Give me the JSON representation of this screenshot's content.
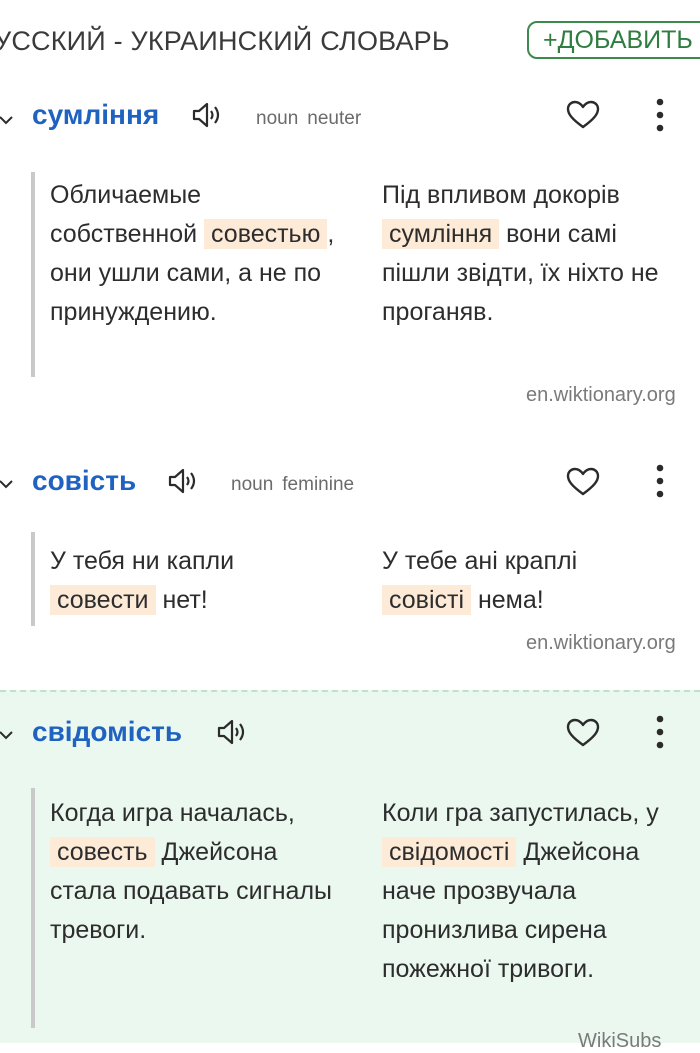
{
  "header": {
    "title": "УССКИЙ - УКРАИНСКИЙ СЛОВАРЬ",
    "add_button": "+ДОБАВИТЬ"
  },
  "entries": [
    {
      "word": "сумління",
      "pos": "noun",
      "gender": "neuter",
      "ru": {
        "before": "Обличаемые собственной",
        "hl": "совестью",
        "after": ", они ушли сами, а не по принуждению."
      },
      "uk": {
        "before": "Під впливом докорів",
        "hl": "сумління",
        "after": " вони самі пішли звідти, їх ніхто не проганяв."
      },
      "source": "en.wiktionary.org"
    },
    {
      "word": "совість",
      "pos": "noun",
      "gender": "feminine",
      "ru": {
        "before": "У тебя ни капли",
        "hl": "совести",
        "after": " нет!"
      },
      "uk": {
        "before": "У тебе ані краплі",
        "hl": "совісті",
        "after": " нема!"
      },
      "source": "en.wiktionary.org"
    },
    {
      "word": "свідомість",
      "ru": {
        "before": "Когда игра началась,",
        "hl": "совесть",
        "after": " Джейсона стала подавать сигналы тревоги."
      },
      "uk": {
        "before": "Коли гра запустилась, у",
        "hl": "свідомості",
        "after": " Джейсона наче прозвучала пронизлива сирена пожежної тривоги."
      },
      "source": "WikiSubs"
    }
  ],
  "icons": {
    "expand": "chevron-down-icon",
    "audio": "speaker-icon",
    "favorite": "heart-icon",
    "more": "more-vertical-icon"
  },
  "colors": {
    "word": "#1f62c0",
    "highlight": "#fdebd8",
    "accent_green": "#3c8a4e",
    "selected_bg": "#eaf8ef"
  }
}
